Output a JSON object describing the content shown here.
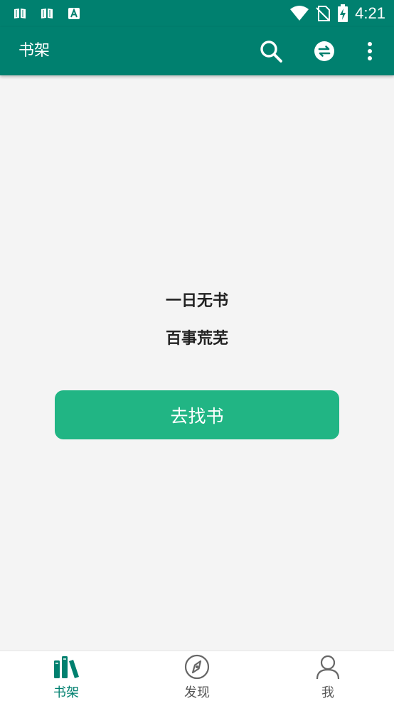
{
  "status_bar": {
    "time": "4:21",
    "icons": [
      "book-notification-icon",
      "book-notification-icon",
      "text-notification-icon",
      "wifi-icon",
      "no-sim-icon",
      "battery-charging-icon"
    ]
  },
  "app_bar": {
    "title": "书架",
    "actions": [
      "search-icon",
      "sync-icon",
      "more-vert-icon"
    ]
  },
  "empty_state": {
    "line1": "一日无书",
    "line2": "百事荒芜",
    "button_label": "去找书"
  },
  "bottom_nav": {
    "items": [
      {
        "label": "书架",
        "icon": "bookshelf-icon",
        "active": true
      },
      {
        "label": "发现",
        "icon": "compass-icon",
        "active": false
      },
      {
        "label": "我",
        "icon": "person-icon",
        "active": false
      }
    ]
  },
  "colors": {
    "primary": "#00806f",
    "accent_button": "#21b584",
    "background": "#f4f4f4",
    "nav_active": "#00806f",
    "nav_inactive": "#666666"
  }
}
